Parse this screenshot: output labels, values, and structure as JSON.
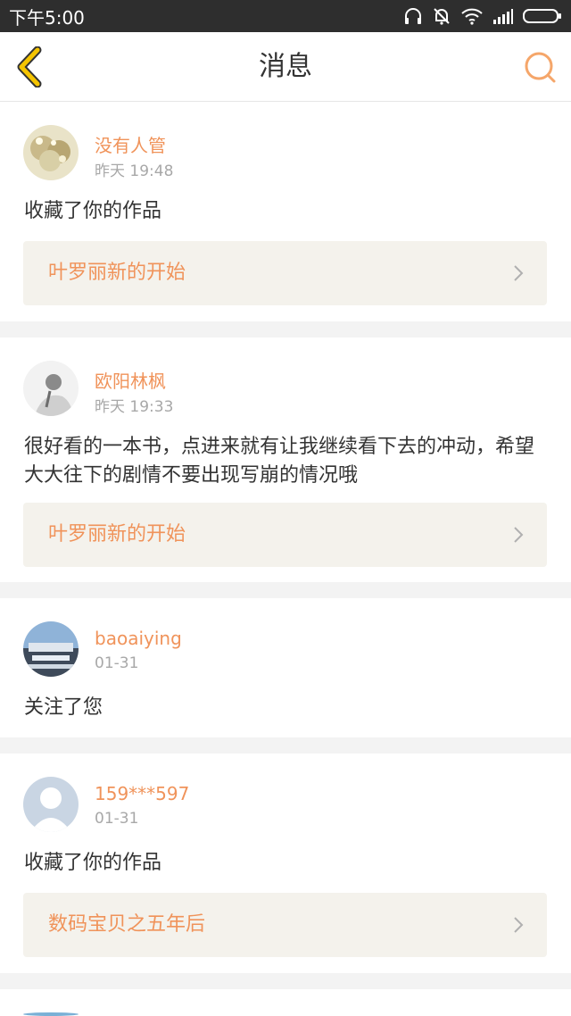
{
  "status_bar": {
    "time": "下午5:00"
  },
  "header": {
    "title": "消息",
    "back_icon": "back-chevron-icon",
    "search_icon": "search-icon",
    "accent": "#f5c400"
  },
  "messages": [
    {
      "user": "没有人管",
      "time": "昨天 19:48",
      "text": "收藏了你的作品",
      "work": "叶罗丽新的开始"
    },
    {
      "user": "欧阳林枫",
      "time": "昨天 19:33",
      "text": "很好看的一本书，点进来就有让我继续看下去的冲动，希望大大往下的剧情不要出现写崩的情况哦",
      "work": "叶罗丽新的开始"
    },
    {
      "user": "baoaiying",
      "time": "01-31",
      "text": "关注了您"
    },
    {
      "user": "159***597",
      "time": "01-31",
      "text": "收藏了你的作品",
      "work": "数码宝贝之五年后"
    }
  ],
  "colors": {
    "username": "#f0935a",
    "work_bg": "#f4f2ec",
    "search": "#f5a66a"
  }
}
